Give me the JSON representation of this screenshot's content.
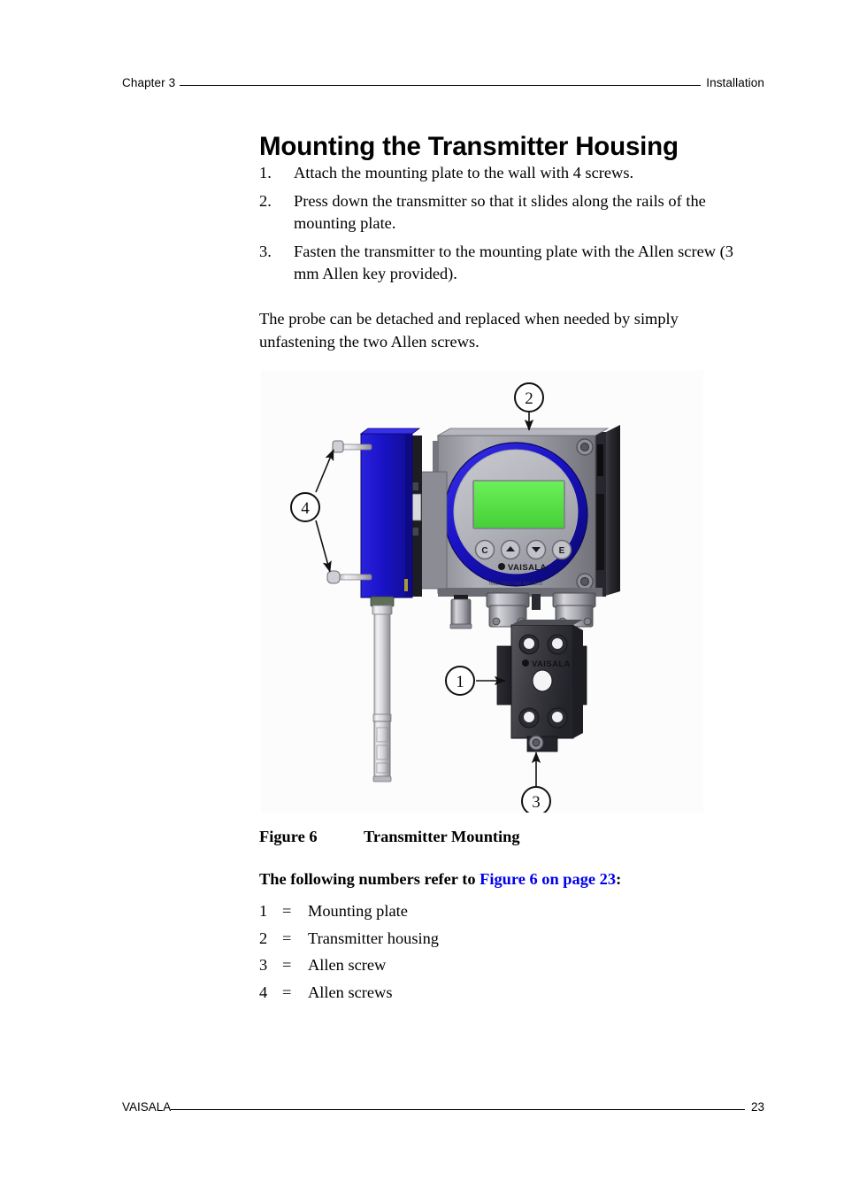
{
  "header": {
    "chapter": "Chapter 3",
    "section": "Installation"
  },
  "title": "Mounting the Transmitter Housing",
  "steps": [
    {
      "num": "1.",
      "text": "Attach the mounting plate to the wall with 4 screws."
    },
    {
      "num": "2.",
      "text": "Press down the transmitter so that it slides along the rails of the mounting plate."
    },
    {
      "num": "3.",
      "text": "Fasten the transmitter to the mounting plate with the Allen screw (3 mm Allen key provided)."
    }
  ],
  "paragraph": "The probe can be detached and replaced when needed by simply unfastening the two Allen screws.",
  "figure": {
    "caption_label": "Figure 6",
    "caption_text": "Transmitter Mounting",
    "callouts": [
      {
        "id": "1",
        "label": "1",
        "target": "mounting-plate"
      },
      {
        "id": "2",
        "label": "2",
        "target": "transmitter-housing"
      },
      {
        "id": "3",
        "label": "3",
        "target": "allen-screw"
      },
      {
        "id": "4",
        "label": "4",
        "target": "allen-screws"
      }
    ],
    "keypad_buttons": [
      "C",
      "▲",
      "▼",
      "E"
    ],
    "brand": "VAISALA",
    "display_color": "#55dd44",
    "housing_ring_color": "#1a13c8",
    "probe_body_color": "#1a13c8",
    "housing_body_color": "#9a9aa2"
  },
  "reference": {
    "prefix": "The following numbers refer to ",
    "link": "Figure 6 on page 23",
    "suffix": ":"
  },
  "legend": [
    {
      "num": "1",
      "eq": "=",
      "text": "Mounting plate"
    },
    {
      "num": "2",
      "eq": "=",
      "text": "Transmitter housing"
    },
    {
      "num": "3",
      "eq": "=",
      "text": "Allen screw"
    },
    {
      "num": "4",
      "eq": "=",
      "text": "Allen screws"
    }
  ],
  "footer": {
    "brand": "VAISALA",
    "page_number": "23"
  },
  "colors": {
    "link": "#0000ee",
    "text": "#000000",
    "figure_background": "#fcfcfc"
  }
}
